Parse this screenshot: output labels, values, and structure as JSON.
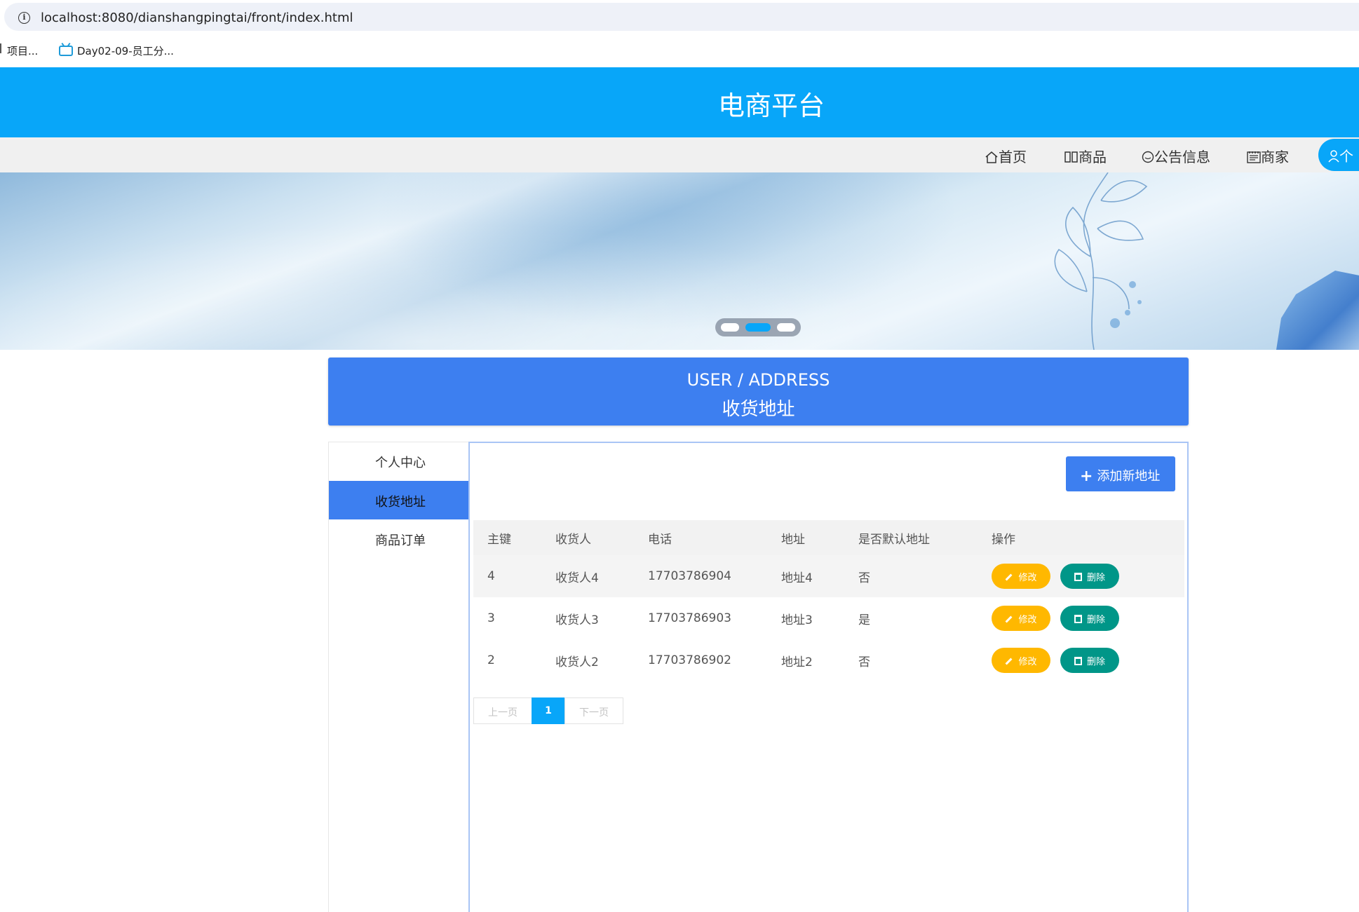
{
  "browser": {
    "url": "localhost:8080/dianshangpingtai/front/index.html",
    "bookmarks": [
      {
        "label": "项目..."
      },
      {
        "label": "Day02-09-员工分..."
      }
    ]
  },
  "site": {
    "title": "电商平台",
    "brand_color": "#08a6f9"
  },
  "nav": {
    "items": [
      {
        "label": "首页",
        "icon": "home-icon"
      },
      {
        "label": "商品",
        "icon": "goods-icon"
      },
      {
        "label": "公告信息",
        "icon": "notice-icon"
      },
      {
        "label": "商家",
        "icon": "shop-icon"
      }
    ],
    "user_label": "个"
  },
  "banner": {
    "active_slide": 2,
    "slide_count": 3
  },
  "page_heading": {
    "en": "USER / ADDRESS",
    "zh": "收货地址"
  },
  "side_menu": {
    "items": [
      {
        "label": "个人中心",
        "active": false
      },
      {
        "label": "收货地址",
        "active": true
      },
      {
        "label": "商品订单",
        "active": false
      }
    ]
  },
  "toolbar": {
    "add_label": "添加新地址"
  },
  "table": {
    "headers": [
      "主键",
      "收货人",
      "电话",
      "地址",
      "是否默认地址",
      "操作"
    ],
    "rows": [
      {
        "id": "4",
        "name": "收货人4",
        "phone": "17703786904",
        "address": "地址4",
        "is_default": "否"
      },
      {
        "id": "3",
        "name": "收货人3",
        "phone": "17703786903",
        "address": "地址3",
        "is_default": "是"
      },
      {
        "id": "2",
        "name": "收货人2",
        "phone": "17703786902",
        "address": "地址2",
        "is_default": "否"
      }
    ],
    "edit_label": "修改",
    "delete_label": "删除",
    "edit_color": "#ffb800",
    "delete_color": "#009688"
  },
  "pagination": {
    "prev": "上一页",
    "current": "1",
    "next": "下一页"
  }
}
